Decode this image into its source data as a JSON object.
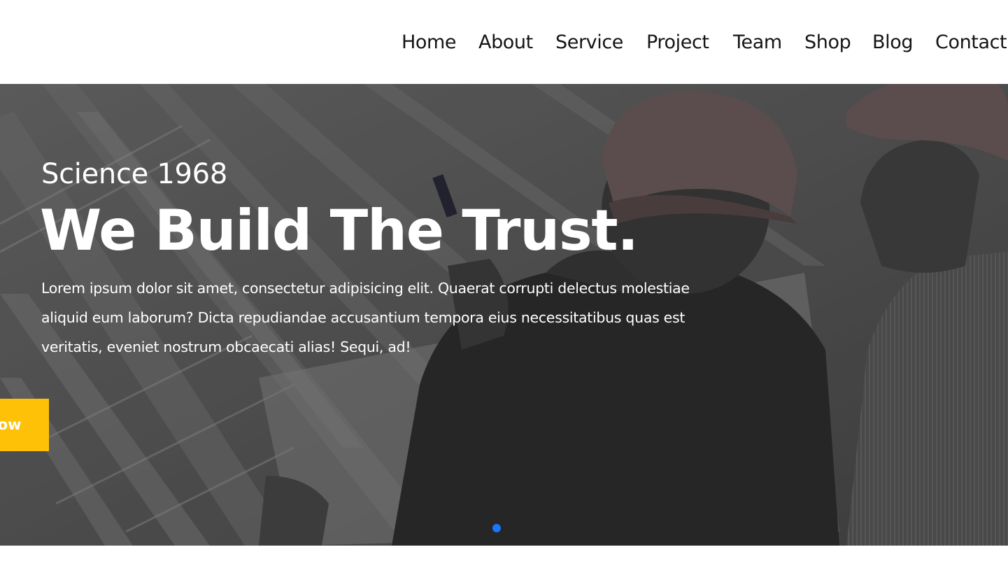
{
  "nav": {
    "items": [
      {
        "label": "Home"
      },
      {
        "label": "About"
      },
      {
        "label": "Service"
      },
      {
        "label": "Project"
      },
      {
        "label": "Team"
      },
      {
        "label": "Shop"
      },
      {
        "label": "Blog"
      },
      {
        "label": "Contact"
      }
    ]
  },
  "hero": {
    "subtitle": "Science 1968",
    "title": "We Build The Trust.",
    "text": "Lorem ipsum dolor sit amet, consectetur adipisicing elit. Quaerat corrupti delectus molestiae aliquid eum laborum? Dicta repudiandae accusantium tempora eius necessitatibus quas est veritatis, eveniet nostrum obcaecati alias! Sequi, ad!",
    "button_label": "Know",
    "background": "photo of two engineers in hard hats reviewing plans (grayscale)"
  },
  "slider": {
    "dot_count": 1,
    "active_index": 0
  },
  "colors": {
    "accent": "#ffc107",
    "dot_active": "#1976ff",
    "nav_text": "#151515",
    "hero_text": "#ffffff"
  }
}
